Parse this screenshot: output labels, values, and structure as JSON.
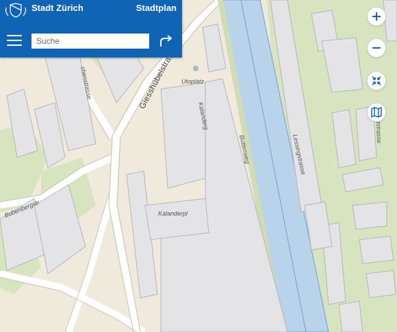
{
  "header": {
    "brand": "Stadt Zürich",
    "app_title": "Stadtplan",
    "search_placeholder": "Suche"
  },
  "controls": {
    "zoom_in": "zoom-in",
    "zoom_out": "zoom-out",
    "fullscreen": "fullscreen",
    "basemap": "basemap"
  },
  "map": {
    "streets": {
      "giesshuebelstrasse": "Giesshübelstrasse",
      "utoplatz": "Utoplatz",
      "kalanderg": "Kalanderg",
      "buttenweg": "Buttenweg",
      "lessingstrasse": "Lessingstrasse",
      "kalanderpl": "Kalanderpl",
      "bubenbergstr": "Bubenbergstr",
      "chenstrasse": "chenstrasse",
      "tstrasse": "tstrasse"
    }
  }
}
